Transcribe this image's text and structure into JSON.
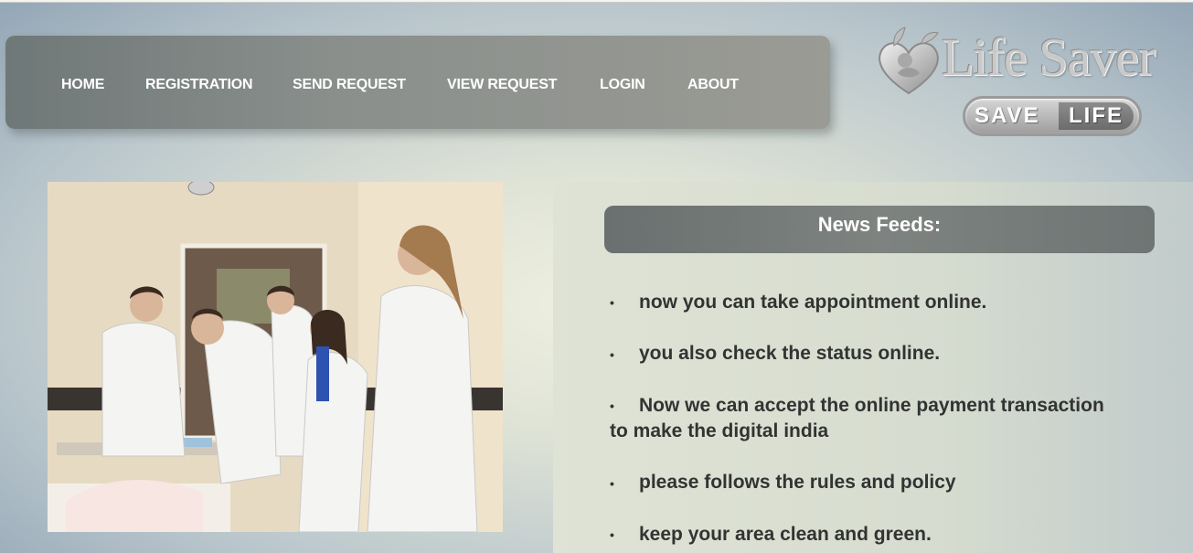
{
  "nav": {
    "items": [
      {
        "label": "HOME"
      },
      {
        "label": "REGISTRATION"
      },
      {
        "label": "SEND REQUEST"
      },
      {
        "label": "VIEW REQUEST"
      },
      {
        "label": "LOGIN"
      },
      {
        "label": "ABOUT"
      }
    ]
  },
  "logo": {
    "title": "Life Saver",
    "badge_left": "SAVE",
    "badge_right": "LIFE"
  },
  "news": {
    "title": "News Feeds:",
    "items": [
      "now you can take appointment online.",
      "you also check the status online.",
      "Now we can accept the online payment transaction to make the digital india",
      "please follows the rules and policy",
      "keep your area clean and green."
    ]
  },
  "colors": {
    "nav_bg": "#8a8f8c",
    "header_bg": "#6a706f",
    "text": "#333333"
  }
}
